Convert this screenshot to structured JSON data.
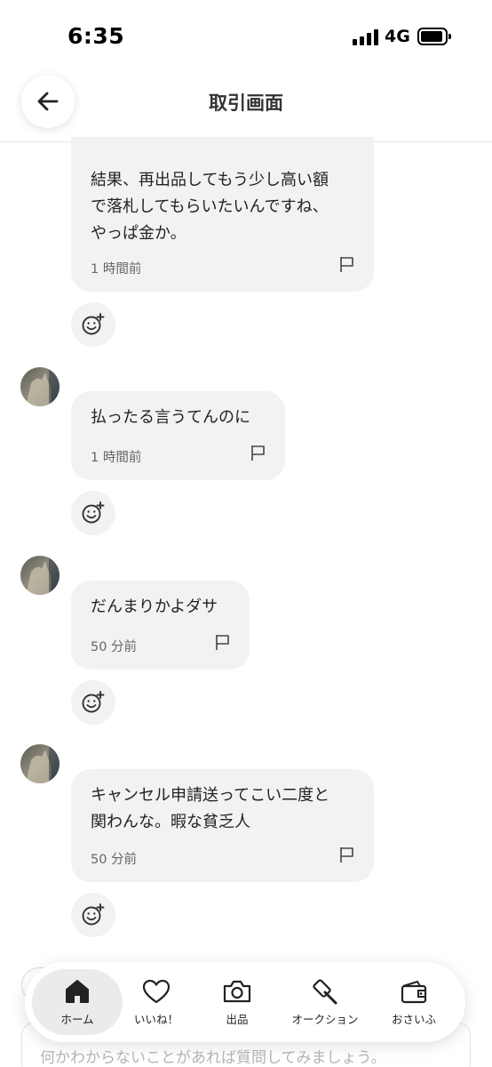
{
  "status_bar": {
    "time": "6:35",
    "network": "4G"
  },
  "header": {
    "title": "取引画面"
  },
  "messages": [
    {
      "text": "結果、再出品してもう少し高い額\nで落札してもらいたいんですね、\nやっぱ金か。",
      "time": "1 時間前"
    },
    {
      "text": "払ったる言うてんのに",
      "time": "1 時間前"
    },
    {
      "text": "だんまりかよダサ",
      "time": "50 分前"
    },
    {
      "text": "キャンセル申請送ってこい二度と\n関わんな。暇な貧乏人",
      "time": "50 分前"
    }
  ],
  "input": {
    "placeholder": "何かわからないことがあれば質問してみましょう。"
  },
  "nav": {
    "items": [
      {
        "label": "ホーム",
        "icon": "home-icon",
        "active": true
      },
      {
        "label": "いいね！",
        "icon": "heart-icon",
        "active": false
      },
      {
        "label": "出品",
        "icon": "camera-icon",
        "active": false
      },
      {
        "label": "オークション",
        "icon": "gavel-icon",
        "active": false
      },
      {
        "label": "おさいふ",
        "icon": "wallet-icon",
        "active": false
      }
    ]
  }
}
